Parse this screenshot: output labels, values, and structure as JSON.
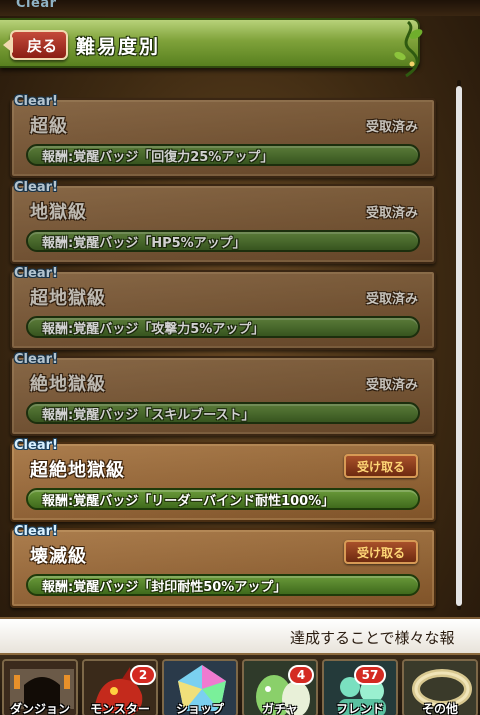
{
  "header": {
    "back_label": "戻る",
    "title": "難易度別"
  },
  "top_strip": {
    "clear_label": "Clear"
  },
  "cards": [
    {
      "clear": "Clear!",
      "title": "超級",
      "status": "受取済み",
      "claimed": true,
      "reward": "報酬:覚醒バッジ「回復力25%アップ」"
    },
    {
      "clear": "Clear!",
      "title": "地獄級",
      "status": "受取済み",
      "claimed": true,
      "reward": "報酬:覚醒バッジ「HP5%アップ」"
    },
    {
      "clear": "Clear!",
      "title": "超地獄級",
      "status": "受取済み",
      "claimed": true,
      "reward": "報酬:覚醒バッジ「攻撃力5%アップ」"
    },
    {
      "clear": "Clear!",
      "title": "絶地獄級",
      "status": "受取済み",
      "claimed": true,
      "reward": "報酬:覚醒バッジ「スキルブースト」"
    },
    {
      "clear": "Clear!",
      "title": "超絶地獄級",
      "status": "受け取る",
      "claimed": false,
      "reward": "報酬:覚醒バッジ「リーダーバインド耐性100%」"
    },
    {
      "clear": "Clear!",
      "title": "壊滅級",
      "status": "受け取る",
      "claimed": false,
      "reward": "報酬:覚醒バッジ「封印耐性50%アップ」"
    }
  ],
  "ticker": {
    "text": "達成することで様々な報"
  },
  "tabs": [
    {
      "label": "ダンジョン",
      "badge": null,
      "icon": "dungeon-gate-icon"
    },
    {
      "label": "モンスター",
      "badge": "2",
      "icon": "red-dragon-icon"
    },
    {
      "label": "ショップ",
      "badge": null,
      "icon": "rainbow-stone-icon"
    },
    {
      "label": "ガチャ",
      "badge": "4",
      "icon": "egg-icon"
    },
    {
      "label": "フレンド",
      "badge": "57",
      "icon": "friends-icon"
    },
    {
      "label": "その他",
      "badge": null,
      "icon": "other-ring-icon"
    }
  ],
  "colors": {
    "header_green": "#7fa23a",
    "card_brown": "#8a5a2c",
    "reward_green": "#4f7f28",
    "claim_button": "#8a3a18",
    "badge_red": "#d42a22"
  }
}
